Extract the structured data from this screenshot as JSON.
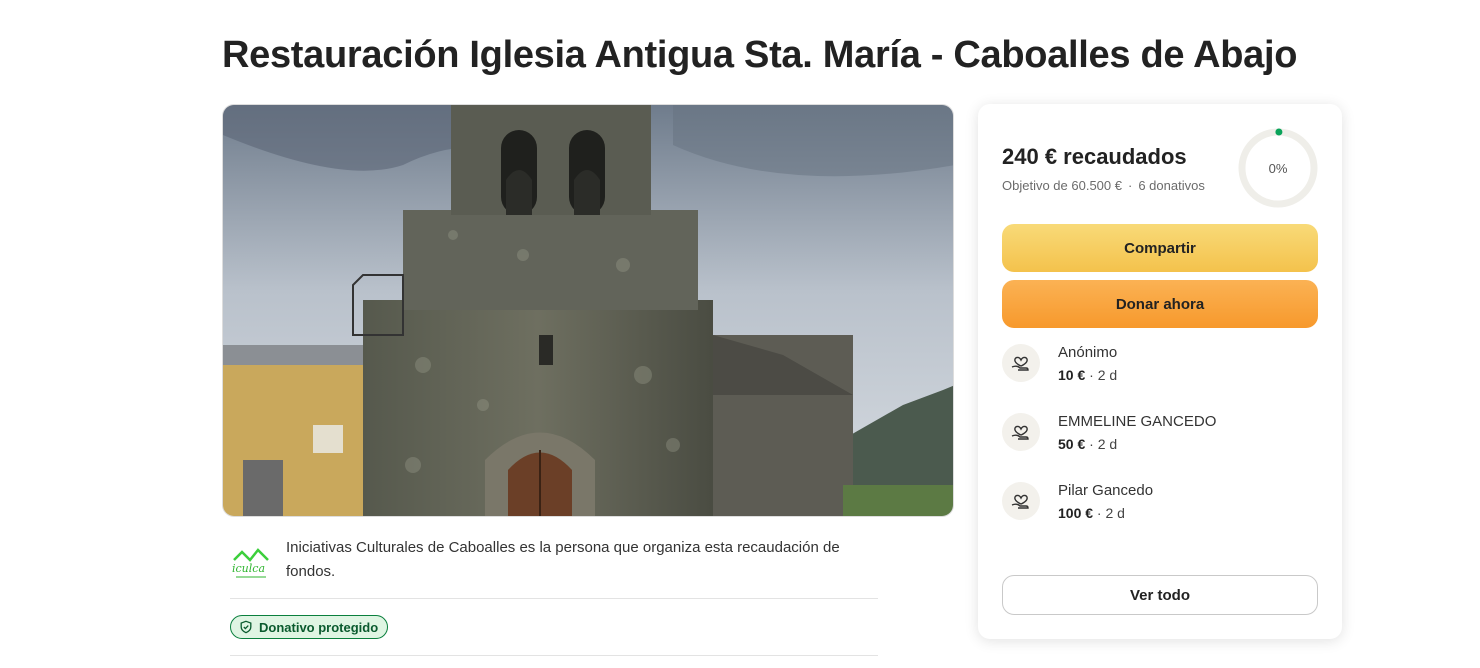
{
  "campaign": {
    "title": "Restauración Iglesia Antigua Sta. María - Caboalles de Abajo"
  },
  "organizer": {
    "text": "Iniciativas Culturales de Caboalles es la persona que organiza esta recaudación de fondos.",
    "logo_text": "iculca"
  },
  "badge": {
    "protected_label": "Donativo protegido"
  },
  "donation_card": {
    "raised": "240 € recaudados",
    "goal": "Objetivo de 60.500 €",
    "separator": "·",
    "donations_count": "6 donativos",
    "progress_label": "0%",
    "progress_fraction": 0.004,
    "share_label": "Compartir",
    "donate_label": "Donar ahora",
    "view_all_label": "Ver todo",
    "donors": [
      {
        "name": "Anónimo",
        "amount": "10 €",
        "time": " · 2 d"
      },
      {
        "name": "EMMELINE GANCEDO",
        "amount": "50 €",
        "time": " · 2 d"
      },
      {
        "name": "Pilar Gancedo",
        "amount": "100 €",
        "time": " · 2 d"
      }
    ]
  },
  "colors": {
    "share_button": "#f4c24c",
    "donate_button": "#f7992c",
    "progress_dot": "#0aa35a",
    "badge_border": "#0a7f3d"
  },
  "icons": {
    "donor_avatar": "heart-hand-icon",
    "badge": "shield-check-icon"
  }
}
